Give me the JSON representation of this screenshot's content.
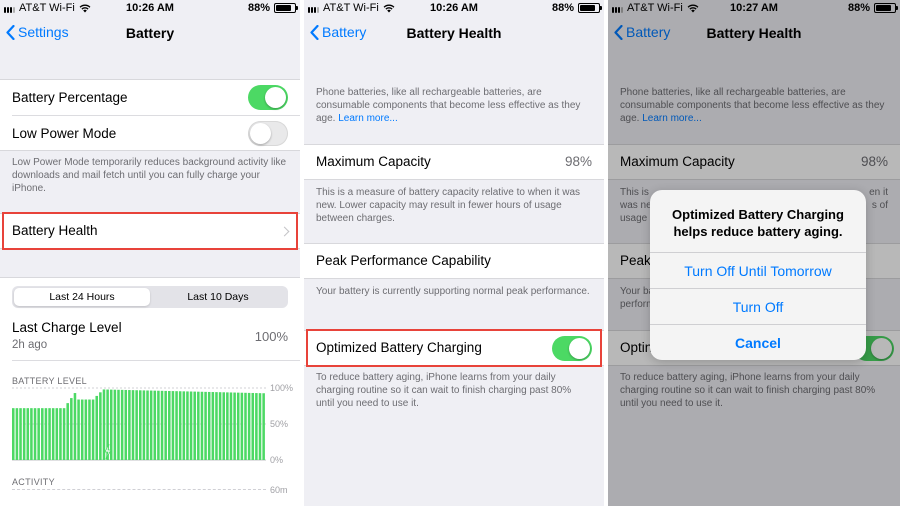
{
  "colors": {
    "accent": "#007aff",
    "toggle_on": "#4cd964",
    "chart_bar": "#4cd964",
    "highlight": "#e8433a"
  },
  "panel1": {
    "status": {
      "carrier": "AT&T Wi-Fi",
      "time": "10:26 AM",
      "battery": "88%"
    },
    "nav": {
      "back": "Settings",
      "title": "Battery"
    },
    "rows": {
      "battery_percentage": {
        "label": "Battery Percentage",
        "on": true
      },
      "low_power_mode": {
        "label": "Low Power Mode",
        "on": false
      }
    },
    "low_power_note": "Low Power Mode temporarily reduces background activity like downloads and mail fetch until you can fully charge your iPhone.",
    "battery_health": {
      "label": "Battery Health"
    },
    "tabs": [
      "Last 24 Hours",
      "Last 10 Days"
    ],
    "last_charge": {
      "label": "Last Charge Level",
      "time": "2h ago",
      "value": "100%"
    },
    "battery_level_label": "BATTERY LEVEL",
    "level_axis": [
      "100%",
      "50%",
      "0%"
    ],
    "activity_label": "ACTIVITY",
    "activity_axis": "60m"
  },
  "panel2": {
    "status": {
      "carrier": "AT&T Wi-Fi",
      "time": "10:26 AM",
      "battery": "88%"
    },
    "nav": {
      "back": "Battery",
      "title": "Battery Health"
    },
    "intro": "Phone batteries, like all rechargeable batteries, are consumable components that become less effective as they age.",
    "learn_more": "Learn more...",
    "max_capacity": {
      "label": "Maximum Capacity",
      "value": "98%"
    },
    "max_capacity_note": "This is a measure of battery capacity relative to when it was new. Lower capacity may result in fewer hours of usage between charges.",
    "peak": {
      "label": "Peak Performance Capability"
    },
    "peak_note": "Your battery is currently supporting normal peak performance.",
    "optimized": {
      "label": "Optimized Battery Charging",
      "on": true
    },
    "optimized_note": "To reduce battery aging, iPhone learns from your daily charging routine so it can wait to finish charging past 80% until you need to use it."
  },
  "panel3": {
    "status": {
      "carrier": "AT&T Wi-Fi",
      "time": "10:27 AM",
      "battery": "88%"
    },
    "nav": {
      "back": "Battery",
      "title": "Battery Health"
    },
    "intro": "Phone batteries, like all rechargeable batteries, are consumable components that become less effective as they age.",
    "learn_more": "Learn more...",
    "max_capacity": {
      "label": "Maximum Capacity",
      "value": "98%"
    },
    "max_note_partial": [
      "This is",
      "was new.",
      "usage be"
    ],
    "max_note_right": [
      "en it",
      "s of"
    ],
    "peak_partial": "Peak",
    "peak_note_partial": [
      "Your ba",
      "perform"
    ],
    "optimized_partial": "Optin",
    "optimized_note": "To reduce battery aging, iPhone learns from your daily charging routine so it can wait to finish charging past 80% until you need to use it.",
    "alert": {
      "message": "Optimized Battery Charging helps reduce battery aging.",
      "buttons": [
        "Turn Off Until Tomorrow",
        "Turn Off",
        "Cancel"
      ]
    }
  }
}
